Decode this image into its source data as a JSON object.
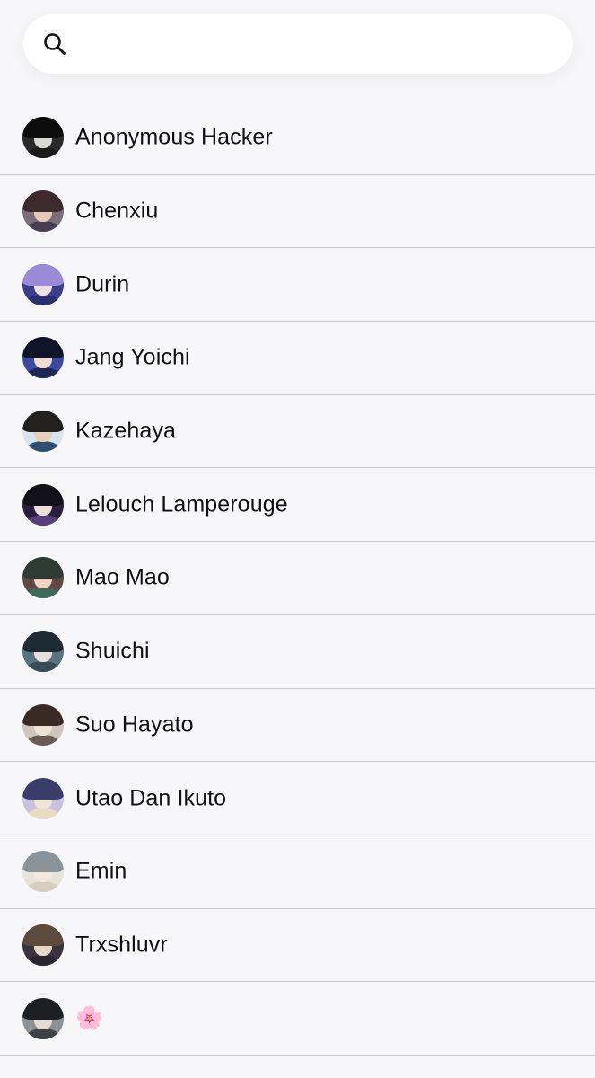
{
  "search": {
    "icon": "search-icon",
    "placeholder": "",
    "value": ""
  },
  "contacts": [
    {
      "name": "Anonymous Hacker",
      "avatar": {
        "bg": "#2a2a2a",
        "hair": "#0d0d0d",
        "face": "#d9d9d4",
        "body": "#1a1a1a"
      }
    },
    {
      "name": "Chenxiu",
      "avatar": {
        "bg": "#7a6f78",
        "hair": "#3b2b2e",
        "face": "#e7c9b8",
        "body": "#4a3d52"
      }
    },
    {
      "name": "Durin",
      "avatar": {
        "bg": "#3b3f8a",
        "hair": "#9a8ad8",
        "face": "#f0e0e6",
        "body": "#2a2f6e"
      }
    },
    {
      "name": "Jang Yoichi",
      "avatar": {
        "bg": "#3b4a9e",
        "hair": "#101428",
        "face": "#f2dcd2",
        "body": "#1d2754"
      }
    },
    {
      "name": "Kazehaya",
      "avatar": {
        "bg": "#d9e4ec",
        "hair": "#23211f",
        "face": "#e8cdb8",
        "body": "#2f4e6e"
      }
    },
    {
      "name": "Lelouch Lamperouge",
      "avatar": {
        "bg": "#2a1f3d",
        "hair": "#121018",
        "face": "#eedfdc",
        "body": "#5a3e7a"
      }
    },
    {
      "name": "Mao Mao",
      "avatar": {
        "bg": "#5e4a44",
        "hair": "#2e3b34",
        "face": "#f0d4c0",
        "body": "#3e6a5c"
      }
    },
    {
      "name": "Shuichi",
      "avatar": {
        "bg": "#5b7280",
        "hair": "#1e2a34",
        "face": "#e6e0dc",
        "body": "#3a4c58"
      }
    },
    {
      "name": "Suo Hayato",
      "avatar": {
        "bg": "#cfc5bd",
        "hair": "#3a2a24",
        "face": "#efe2d6",
        "body": "#6a5a50"
      }
    },
    {
      "name": "Utao Dan Ikuto",
      "avatar": {
        "bg": "#c9c2dc",
        "hair": "#3c3c6a",
        "face": "#f3e6d8",
        "body": "#e6dcc0"
      }
    },
    {
      "name": "Emin",
      "avatar": {
        "bg": "#e8e4dc",
        "hair": "#8a929a",
        "face": "#f2e8dc",
        "body": "#d6cfc0"
      }
    },
    {
      "name": "Trxshluvr",
      "avatar": {
        "bg": "#3a3440",
        "hair": "#5c4a3c",
        "face": "#e8d6c6",
        "body": "#2a2430"
      }
    },
    {
      "name": "🌸",
      "avatar": {
        "bg": "#8a9298",
        "hair": "#1c1f24",
        "face": "#eadbd0",
        "body": "#3c4248"
      }
    }
  ]
}
